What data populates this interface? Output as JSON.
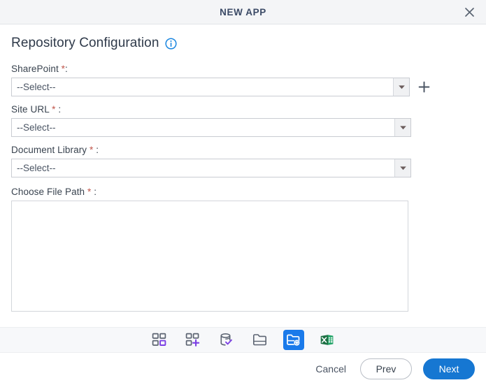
{
  "window": {
    "title": "NEW APP",
    "close_icon": "close-icon"
  },
  "section": {
    "title": "Repository Configuration",
    "info_icon": "info-icon"
  },
  "form": {
    "sharepoint": {
      "label": "SharePoint ",
      "required_mark": "*",
      "label_suffix": ":",
      "value": "--Select--",
      "add_icon": "plus-icon"
    },
    "site_url": {
      "label": "Site URL  ",
      "required_mark": "*",
      "label_suffix": " :",
      "value": "--Select--"
    },
    "document_library": {
      "label": "Document Library  ",
      "required_mark": "*",
      "label_suffix": " :",
      "value": "--Select--"
    },
    "file_path": {
      "label": "Choose File Path  ",
      "required_mark": "*",
      "label_suffix": " :",
      "value": ""
    }
  },
  "toolbar": {
    "items": [
      {
        "name": "grid-view-icon",
        "active": false
      },
      {
        "name": "grid-add-icon",
        "active": false
      },
      {
        "name": "database-check-icon",
        "active": false
      },
      {
        "name": "folder-icon",
        "active": false
      },
      {
        "name": "folder-settings-icon",
        "active": true
      },
      {
        "name": "excel-icon",
        "active": false
      }
    ]
  },
  "footer": {
    "cancel_label": "Cancel",
    "prev_label": "Prev",
    "next_label": "Next"
  },
  "colors": {
    "accent_blue": "#1677d2",
    "active_tool_blue": "#1a7aea",
    "required_red": "#c0564b",
    "purple": "#7b3fe4",
    "excel_green": "#1e7145",
    "titlebar_bg": "#f4f5f7",
    "toolstrip_bg": "#f7f8fa"
  }
}
